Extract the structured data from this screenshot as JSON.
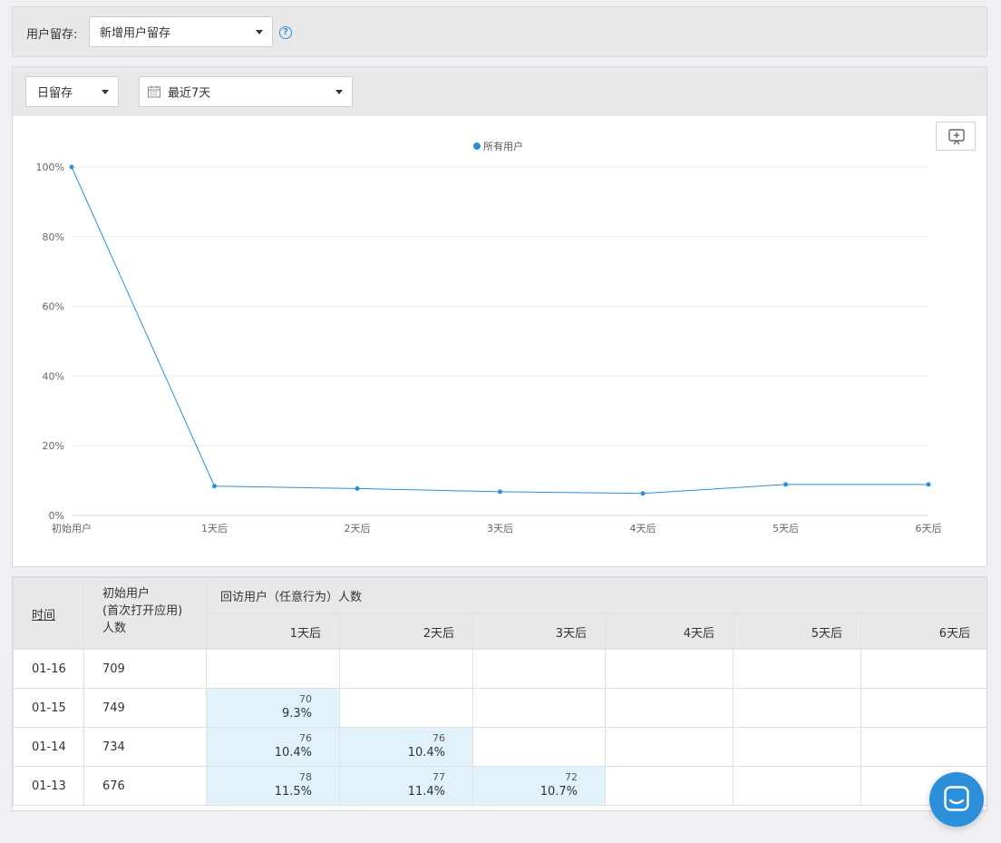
{
  "filter": {
    "label": "用户留存:",
    "retention_type": "新增用户留存",
    "help_glyph": "?"
  },
  "controls": {
    "granularity": "日留存",
    "date_range": "最近7天"
  },
  "chart_data": {
    "type": "line",
    "categories": [
      "初始用户",
      "1天后",
      "2天后",
      "3天后",
      "4天后",
      "5天后",
      "6天后"
    ],
    "series": [
      {
        "name": "所有用户",
        "values": [
          100,
          8.4,
          7.7,
          6.8,
          6.3,
          8.9,
          8.9
        ],
        "color": "#2b8fdb"
      }
    ],
    "ylim": [
      0,
      100
    ],
    "yticks": [
      "0%",
      "20%",
      "40%",
      "60%",
      "80%",
      "100%"
    ],
    "ytick_values": [
      0,
      20,
      40,
      60,
      80,
      100
    ],
    "grid": true,
    "legend_position": "top-center"
  },
  "table": {
    "col_time": "时间",
    "col_init": [
      "初始用户",
      "(首次打开应用)",
      "人数"
    ],
    "col_group": "回访用户（任意行为）人数",
    "days": [
      "1天后",
      "2天后",
      "3天后",
      "4天后",
      "5天后",
      "6天后"
    ],
    "rows": [
      {
        "date": "01-16",
        "init": "709",
        "cells": []
      },
      {
        "date": "01-15",
        "init": "749",
        "cells": [
          {
            "count": "70",
            "pct": "9.3%"
          }
        ]
      },
      {
        "date": "01-14",
        "init": "734",
        "cells": [
          {
            "count": "76",
            "pct": "10.4%"
          },
          {
            "count": "76",
            "pct": "10.4%"
          }
        ]
      },
      {
        "date": "01-13",
        "init": "676",
        "cells": [
          {
            "count": "78",
            "pct": "11.5%"
          },
          {
            "count": "77",
            "pct": "11.4%"
          },
          {
            "count": "72",
            "pct": "10.7%"
          }
        ]
      }
    ]
  },
  "colors": {
    "accent": "#2b8fdb",
    "cell_fill": "#e2f2fb"
  }
}
